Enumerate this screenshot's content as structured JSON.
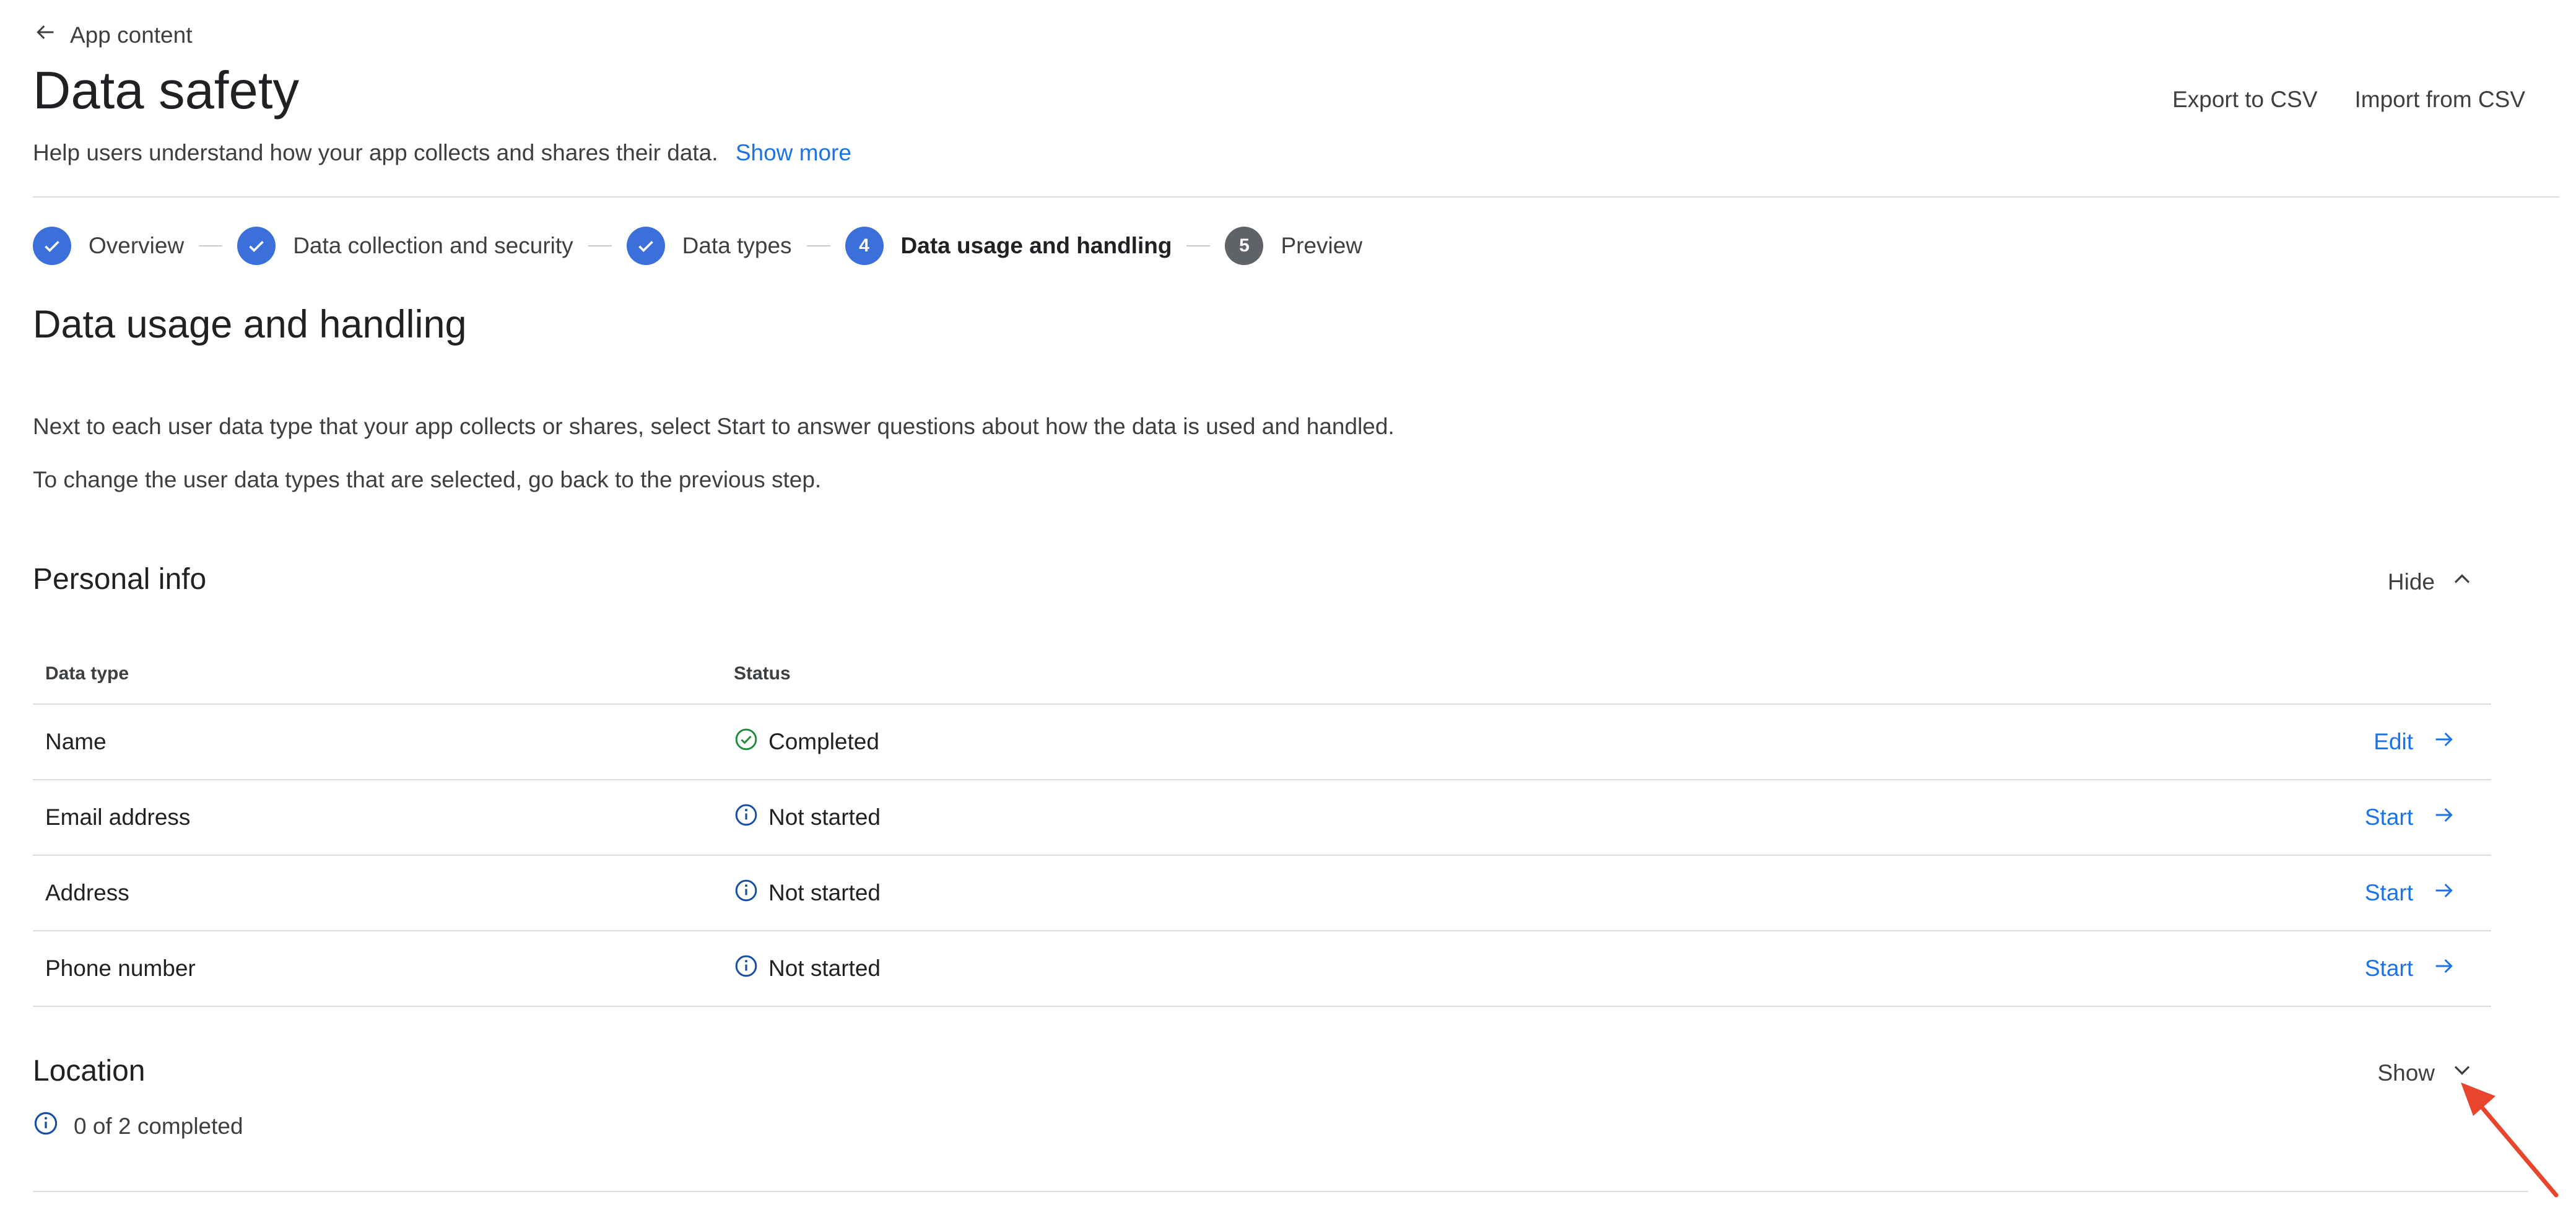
{
  "nav": {
    "back_label": "App content"
  },
  "header": {
    "title": "Data safety",
    "description": "Help users understand how your app collects and shares their data.",
    "show_more": "Show more",
    "export_label": "Export to CSV",
    "import_label": "Import from CSV"
  },
  "stepper": [
    {
      "label": "Overview",
      "state": "done"
    },
    {
      "label": "Data collection and security",
      "state": "done"
    },
    {
      "label": "Data types",
      "state": "done"
    },
    {
      "label": "Data usage and handling",
      "state": "active",
      "number": "4"
    },
    {
      "label": "Preview",
      "state": "todo",
      "number": "5"
    }
  ],
  "section": {
    "title": "Data usage and handling",
    "instruction_1": "Next to each user data type that your app collects or shares, select Start to answer questions about how the data is used and handled.",
    "instruction_2": "To change the user data types that are selected, go back to the previous step."
  },
  "personal_info": {
    "title": "Personal info",
    "toggle_label": "Hide",
    "columns": {
      "data_type": "Data type",
      "status": "Status"
    },
    "rows": [
      {
        "data_type": "Name",
        "status": "Completed",
        "status_icon": "check-circle-icon",
        "action": "Edit"
      },
      {
        "data_type": "Email address",
        "status": "Not started",
        "status_icon": "info-icon",
        "action": "Start"
      },
      {
        "data_type": "Address",
        "status": "Not started",
        "status_icon": "info-icon",
        "action": "Start"
      },
      {
        "data_type": "Phone number",
        "status": "Not started",
        "status_icon": "info-icon",
        "action": "Start"
      }
    ]
  },
  "location": {
    "title": "Location",
    "toggle_label": "Show",
    "summary": "0 of 2 completed"
  },
  "colors": {
    "accent": "#1a73e8",
    "step_done": "#3b6fd9",
    "step_todo": "#5f6368",
    "success": "#1e8e3e",
    "info": "#174ea6",
    "annotation_arrow": "#e8452c"
  }
}
